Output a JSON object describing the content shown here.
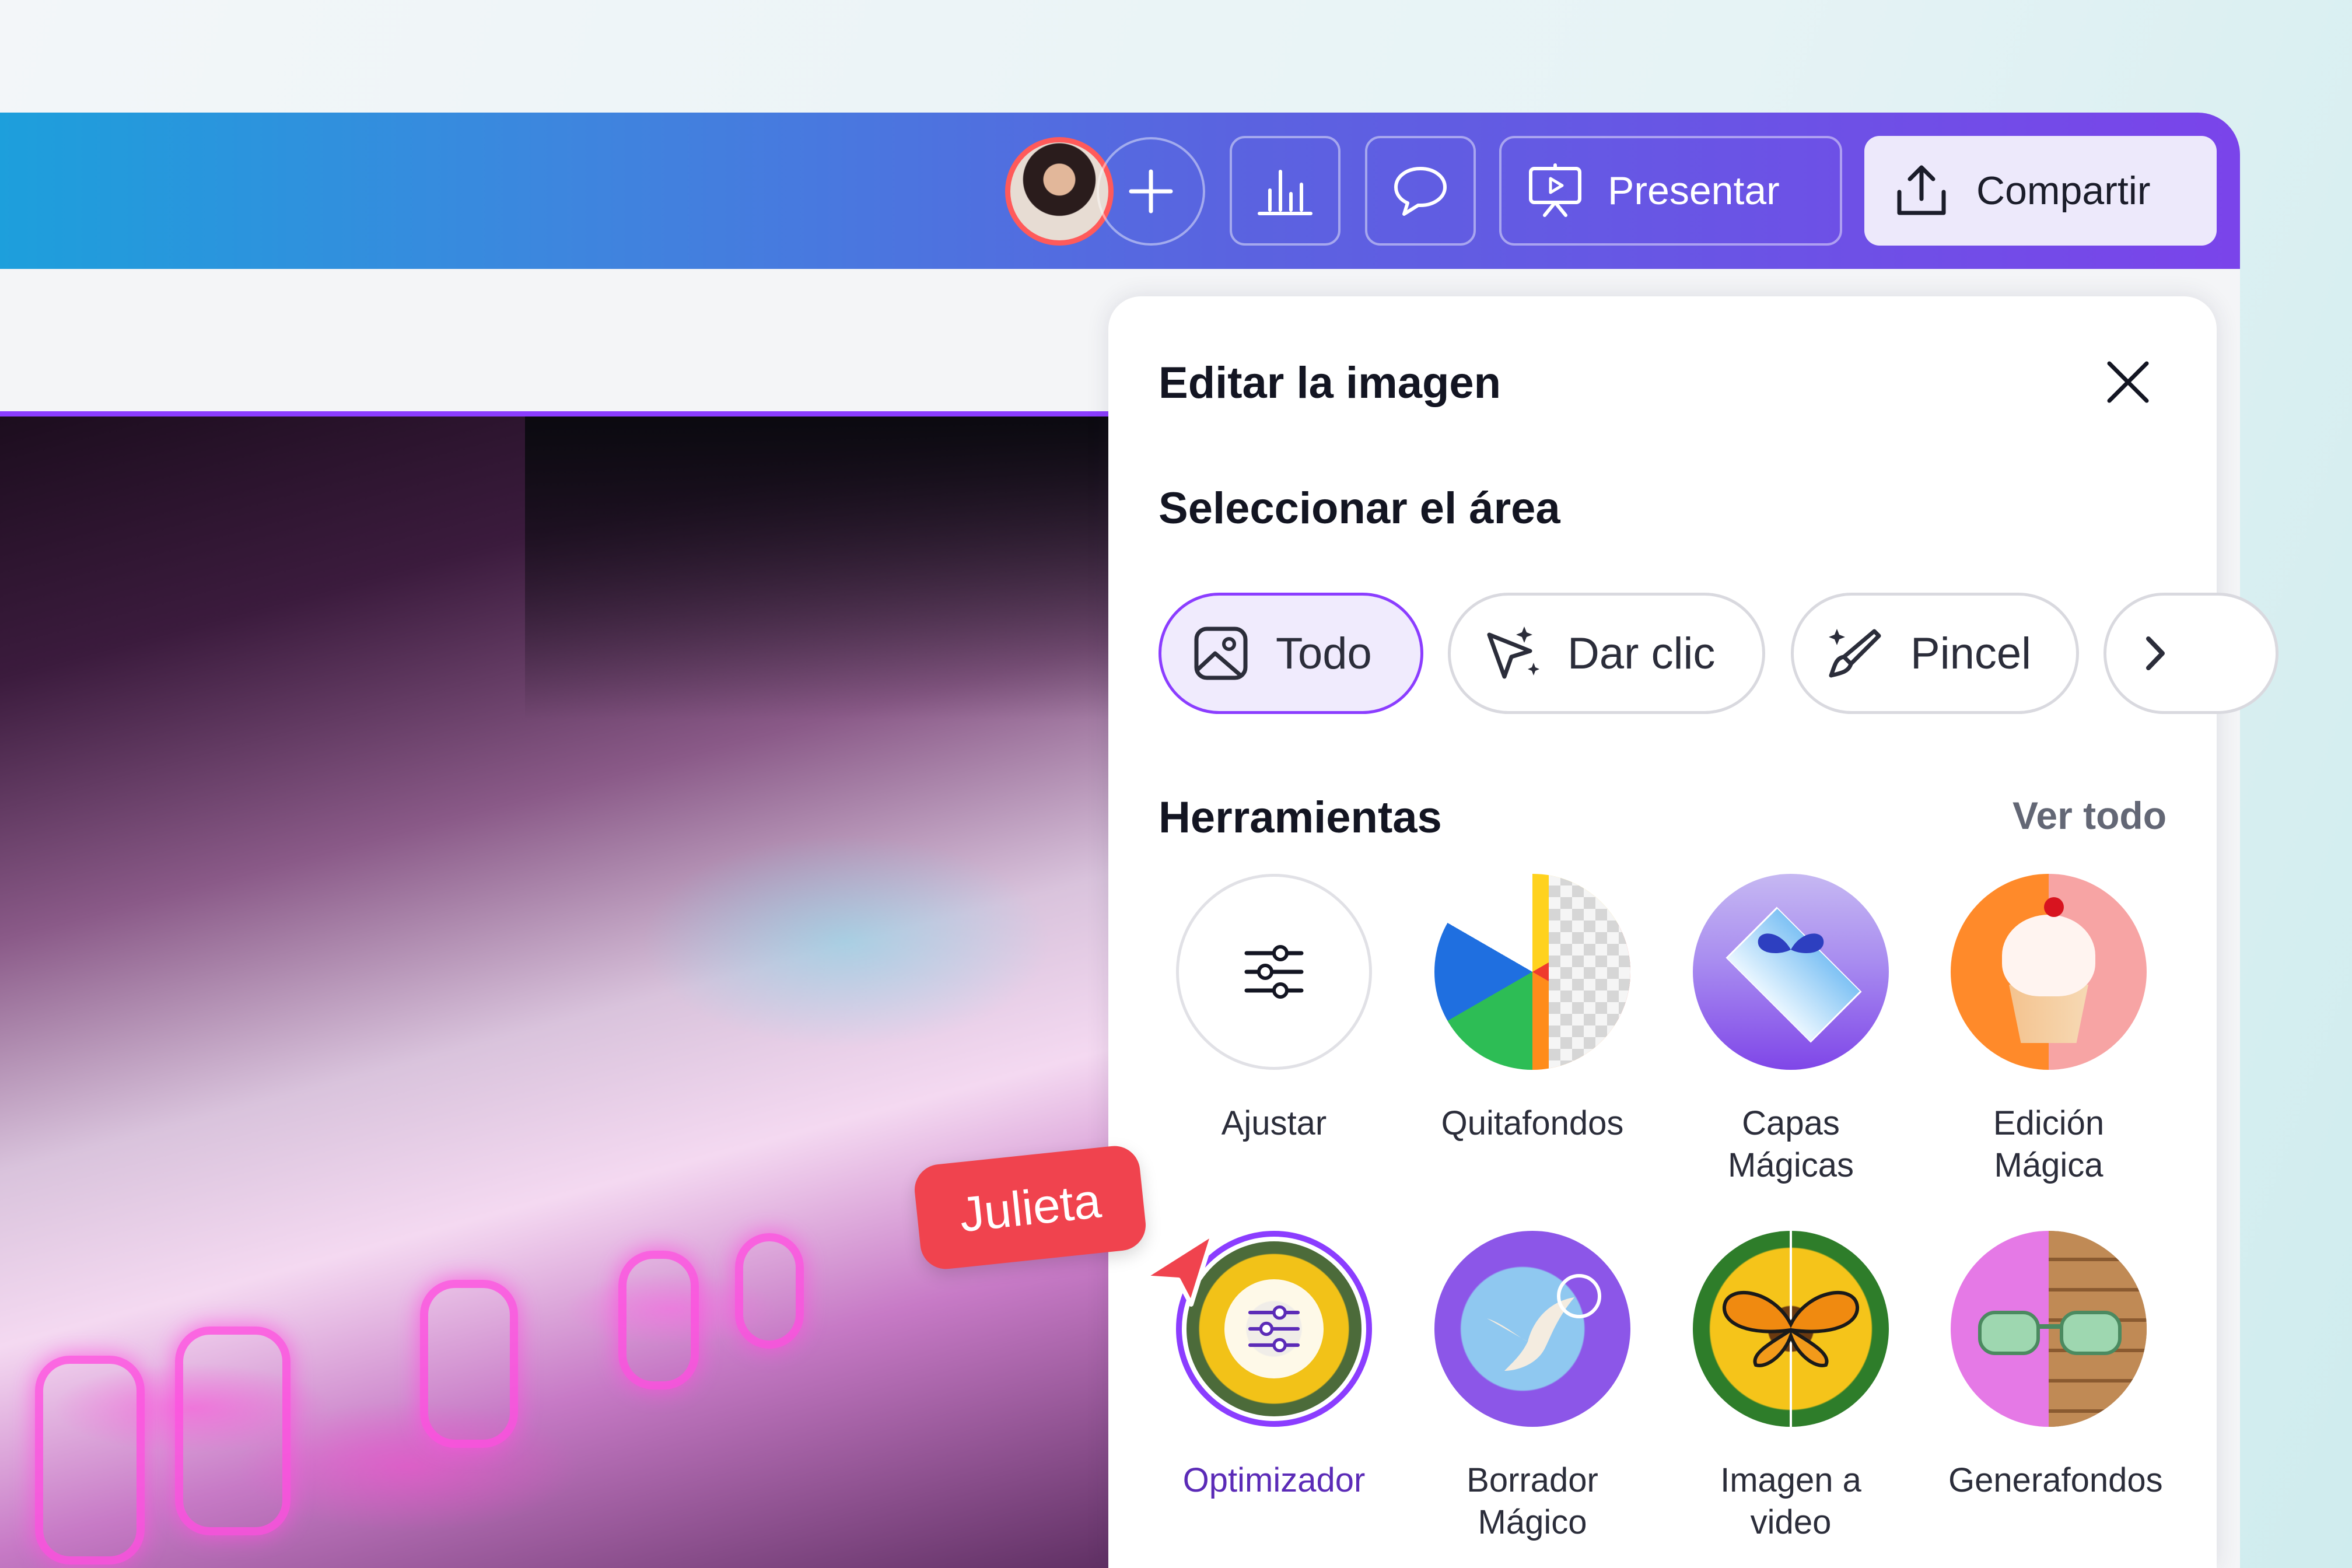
{
  "header": {
    "present_label": "Presentar",
    "share_label": "Compartir"
  },
  "panel": {
    "title": "Editar la imagen",
    "select_area_heading": "Seleccionar el área",
    "selection_modes": [
      {
        "label": "Todo",
        "selected": true
      },
      {
        "label": "Dar clic",
        "selected": false
      },
      {
        "label": "Pincel",
        "selected": false
      }
    ],
    "tools_heading": "Herramientas",
    "see_all_label": "Ver todo",
    "tools": [
      {
        "label": "Ajustar"
      },
      {
        "label": "Quitafondos"
      },
      {
        "label": "Capas Mágicas"
      },
      {
        "label": "Edición Mágica"
      },
      {
        "label": "Optimizador",
        "selected": true
      },
      {
        "label": "Borrador Mágico"
      },
      {
        "label": "Imagen a video"
      },
      {
        "label": "Generafondos"
      }
    ]
  },
  "collaborator": {
    "name": "Julieta",
    "color": "#f0434e"
  },
  "colors": {
    "accent": "#8b3dff"
  }
}
